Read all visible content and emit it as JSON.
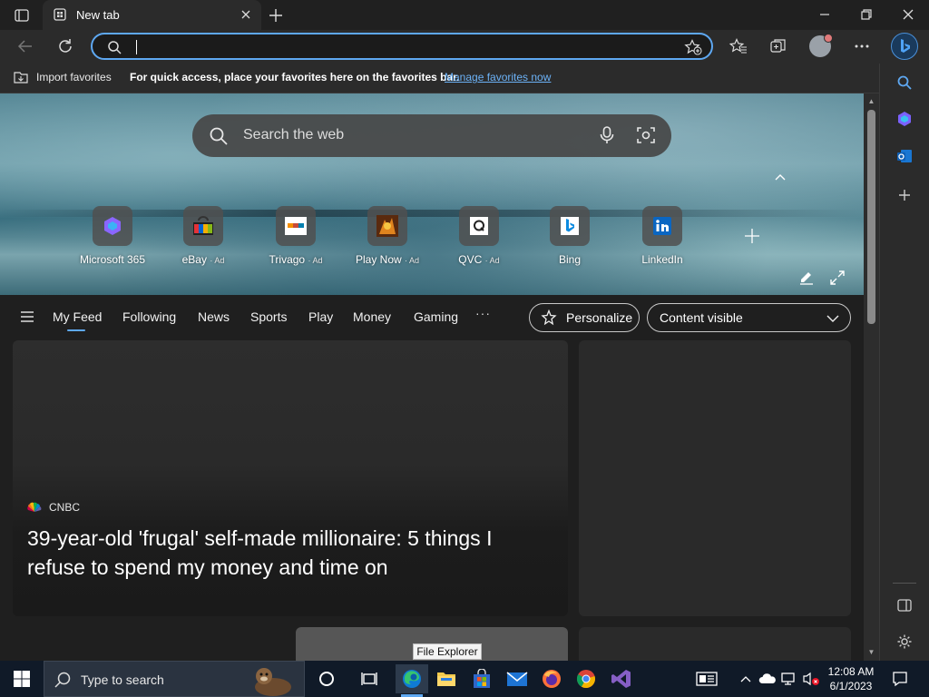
{
  "browser": {
    "tab_title": "New tab",
    "address_value": "",
    "favorites_bar": {
      "import_label": "Import favorites",
      "message": "For quick access, place your favorites here on the favorites bar.",
      "manage_link": "Manage favorites now"
    }
  },
  "newtab": {
    "search_placeholder": "Search the web",
    "quick_links": [
      {
        "label": "Microsoft 365",
        "ad": "",
        "icon": "microsoft365-icon"
      },
      {
        "label": "eBay",
        "ad": "Ad",
        "icon": "ebay-icon"
      },
      {
        "label": "Trivago",
        "ad": "Ad",
        "icon": "trivago-icon"
      },
      {
        "label": "Play Now",
        "ad": "Ad",
        "icon": "playnow-icon"
      },
      {
        "label": "QVC",
        "ad": "Ad",
        "icon": "qvc-icon"
      },
      {
        "label": "Bing",
        "ad": "",
        "icon": "bing-icon"
      },
      {
        "label": "LinkedIn",
        "ad": "",
        "icon": "linkedin-icon"
      }
    ],
    "feed_nav": [
      "My Feed",
      "Following",
      "News",
      "Sports",
      "Play",
      "Money",
      "Gaming"
    ],
    "more_label": "···",
    "personalize_label": "Personalize",
    "content_select_value": "Content visible",
    "card": {
      "source": "CNBC",
      "headline": "39-year-old 'frugal' self-made millionaire: 5 things I refuse to spend my money and time on"
    }
  },
  "tooltip": "File Explorer",
  "taskbar": {
    "search_label": "Type to search",
    "time": "12:08 AM",
    "date": "6/1/2023"
  },
  "colors": {
    "accent": "#5ea8f2",
    "taskbar": "#101a28",
    "browser_chrome": "#2b2b2b"
  }
}
